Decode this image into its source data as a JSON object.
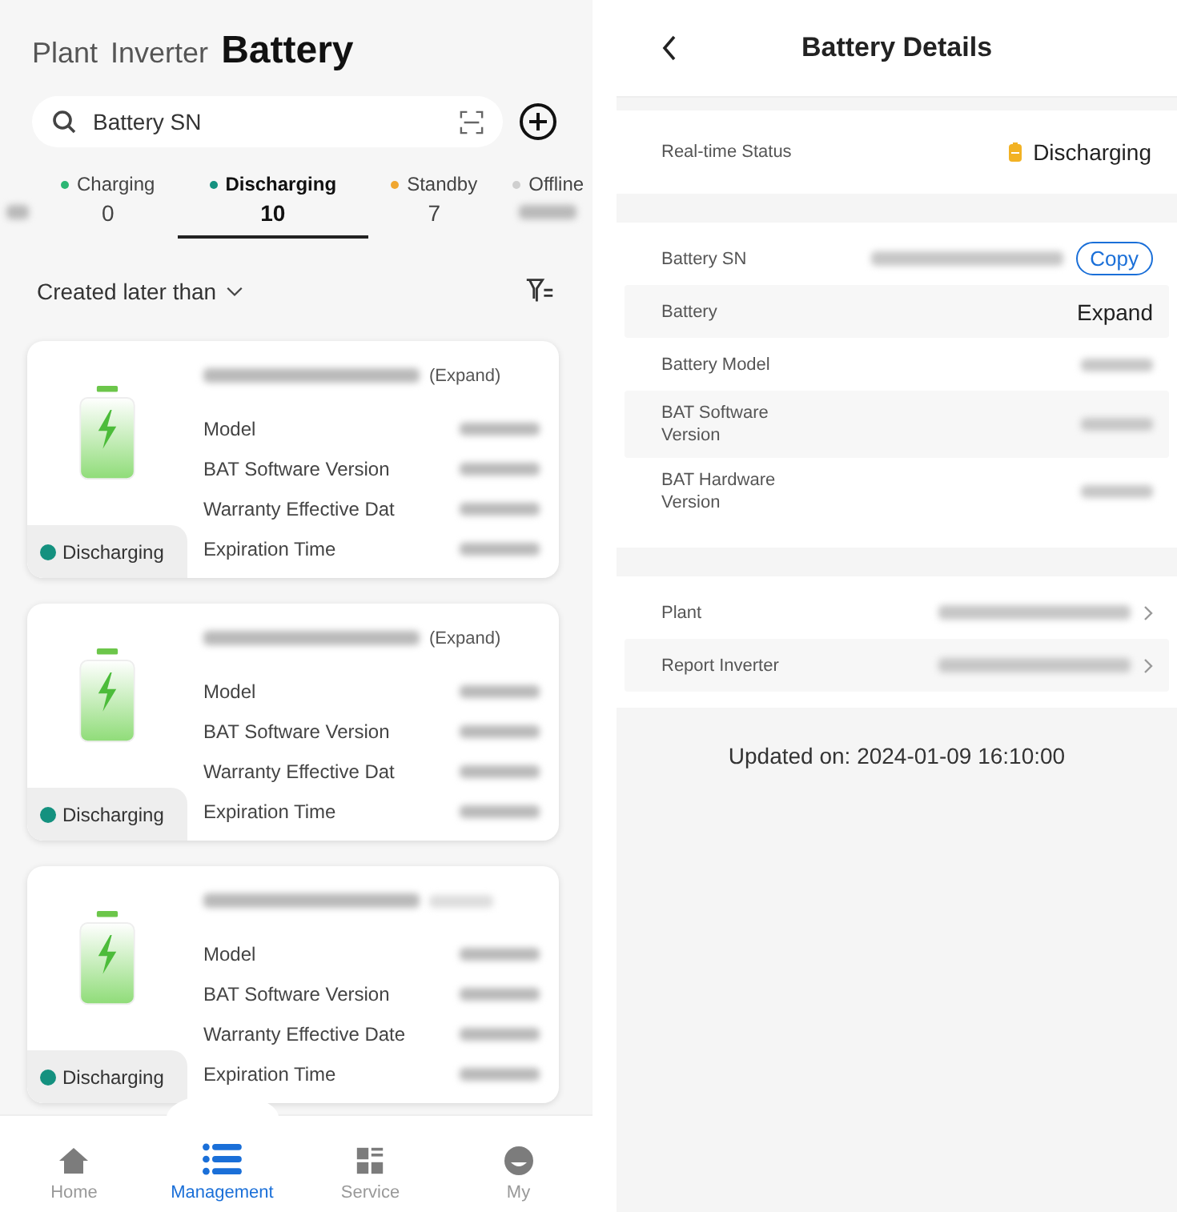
{
  "list_screen": {
    "top_tabs": [
      {
        "label": "Plant",
        "selected": false
      },
      {
        "label": "Inverter",
        "selected": false
      },
      {
        "label": "Battery",
        "selected": true
      }
    ],
    "search": {
      "placeholder": "Battery SN"
    },
    "status_tabs": [
      {
        "label": "Charging",
        "count": "0",
        "color": "#2bb673",
        "selected": false
      },
      {
        "label": "Discharging",
        "count": "10",
        "color": "#14917f",
        "selected": true
      },
      {
        "label": "Standby",
        "count": "7",
        "color": "#f0a630",
        "selected": false
      },
      {
        "label": "Offline",
        "color": "#cfcfcf",
        "selected": false
      }
    ],
    "filter": {
      "label": "Created later than"
    },
    "cards": [
      {
        "expand": "(Expand)",
        "status": "Discharging",
        "fields": [
          "Model",
          "BAT Software Version",
          "Warranty Effective Dat",
          "Expiration Time"
        ]
      },
      {
        "expand": "(Expand)",
        "status": "Discharging",
        "fields": [
          "Model",
          "BAT Software Version",
          "Warranty Effective Dat",
          "Expiration Time"
        ]
      },
      {
        "status": "Discharging",
        "fields": [
          "Model",
          "BAT Software Version",
          "Warranty Effective Date",
          "Expiration Time"
        ]
      }
    ],
    "nav": [
      {
        "label": "Home",
        "kind": "home",
        "selected": false
      },
      {
        "label": "Management",
        "kind": "list",
        "selected": true
      },
      {
        "label": "Service",
        "kind": "grid",
        "selected": false
      },
      {
        "label": "My",
        "kind": "face",
        "selected": false
      }
    ]
  },
  "detail_screen": {
    "title": "Battery Details",
    "status": {
      "label": "Real-time Status",
      "value": "Discharging"
    },
    "info_rows": [
      {
        "label": "Battery SN",
        "kind": "copy",
        "button": "Copy"
      },
      {
        "label": "Battery",
        "kind": "text",
        "value": "Expand"
      },
      {
        "label": "Battery Model",
        "kind": "blurred"
      },
      {
        "label": "BAT Software Version",
        "kind": "blurred"
      },
      {
        "label": "BAT Hardware Version",
        "kind": "blurred"
      }
    ],
    "link_rows": [
      {
        "label": "Plant"
      },
      {
        "label": "Report Inverter"
      }
    ],
    "updated": "Updated on: 2024-01-09 16:10:00"
  }
}
